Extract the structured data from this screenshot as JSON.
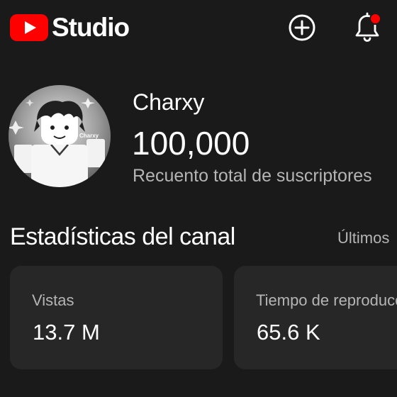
{
  "header": {
    "logo_text": "Studio",
    "logo_icon": "youtube-play-icon",
    "create_icon": "plus-circle-icon",
    "notifications_icon": "bell-icon",
    "brand_color": "#ff0000"
  },
  "profile": {
    "avatar_text": "Charxy",
    "channel_name": "Charxy",
    "subscriber_count": "100,000",
    "subscriber_label": "Recuento total de suscriptores"
  },
  "stats": {
    "title": "Estadísticas del canal",
    "period_label": "Últimos",
    "cards": [
      {
        "label": "Vistas",
        "value": "13.7 M"
      },
      {
        "label": "Tiempo de reproducc",
        "value": "65.6 K"
      }
    ]
  }
}
